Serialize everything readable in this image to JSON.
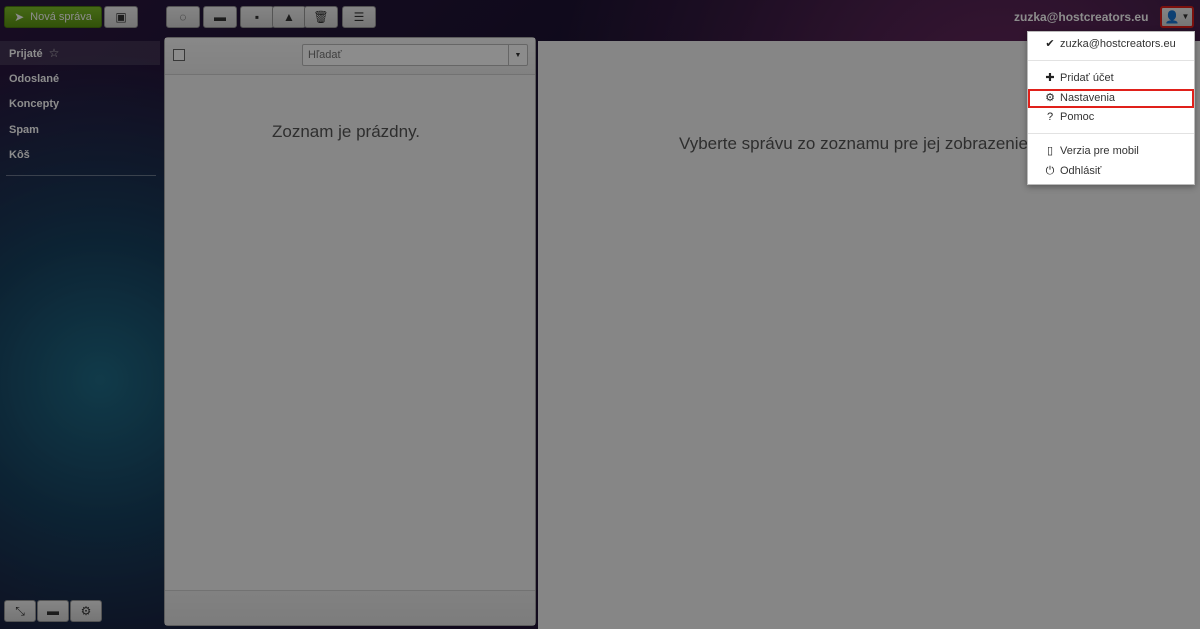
{
  "toolbar": {
    "compose_label": "Nová správa",
    "compose_icon": "paper-plane-icon",
    "contacts_icon": "contacts-icon",
    "refresh_icon": "refresh-icon",
    "move_icon": "folder-icon",
    "archive_icon": "archive-icon",
    "spam_icon": "warning-icon",
    "delete_icon": "trash-icon",
    "more_icon": "menu-icon"
  },
  "account": {
    "email": "zuzka@hostcreators.eu",
    "user_icon": "user-icon"
  },
  "sidebar": {
    "folders": [
      {
        "label": "Prijaté",
        "starred": true
      },
      {
        "label": "Odoslané"
      },
      {
        "label": "Koncepty"
      },
      {
        "label": "Spam"
      },
      {
        "label": "Kôš"
      }
    ]
  },
  "message_list": {
    "search_placeholder": "Hľadať",
    "empty_text": "Zoznam je prázdny."
  },
  "preview": {
    "empty_text": "Vyberte správu zo zoznamu pre jej zobrazenie."
  },
  "account_menu": {
    "items": [
      {
        "label": "zuzka@hostcreators.eu",
        "icon": "check-icon"
      },
      {
        "label": "Pridať účet",
        "icon": "plus-icon"
      },
      {
        "label": "Nastavenia",
        "icon": "gear-icon",
        "highlighted": true
      },
      {
        "label": "Pomoc",
        "icon": "help-icon"
      },
      {
        "label": "Verzia pre mobil",
        "icon": "mobile-icon"
      },
      {
        "label": "Odhlásiť",
        "icon": "power-icon"
      }
    ]
  },
  "colors": {
    "accent_green": "#6aa81d",
    "highlight_red": "#e0201a"
  }
}
